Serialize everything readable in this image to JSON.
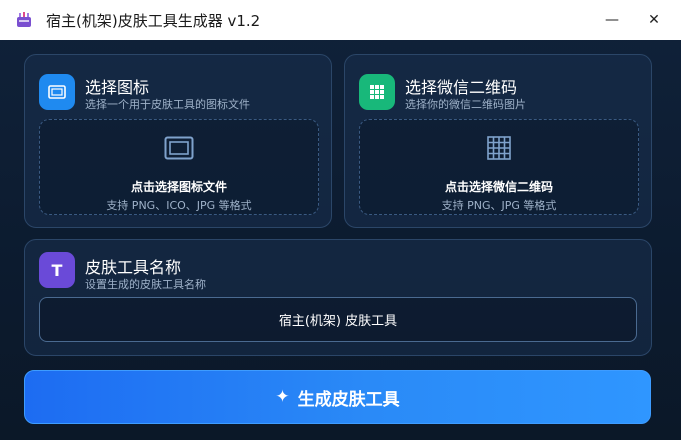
{
  "window": {
    "title": "宿主(机架)皮肤工具生成器 v1.2",
    "minimize_glyph": "—",
    "close_glyph": "✕"
  },
  "icon_panel": {
    "title": "选择图标",
    "subtitle": "选择一个用于皮肤工具的图标文件",
    "drop_label": "点击选择图标文件",
    "drop_hint": "支持 PNG、ICO、JPG 等格式",
    "icon": "monitor-icon",
    "accent": "#1f8af0"
  },
  "qr_panel": {
    "title": "选择微信二维码",
    "subtitle": "选择你的微信二维码图片",
    "drop_label": "点击选择微信二维码",
    "drop_hint": "支持 PNG、JPG 等格式",
    "icon": "grid-icon",
    "accent": "#18b87a"
  },
  "name_panel": {
    "badge": "T",
    "title": "皮肤工具名称",
    "subtitle": "设置生成的皮肤工具名称",
    "input_value": "宿主(机架) 皮肤工具",
    "accent": "#6a4ad8"
  },
  "generate_button": {
    "icon": "sparkle-icon",
    "glyph": "✦",
    "label": "生成皮肤工具"
  }
}
